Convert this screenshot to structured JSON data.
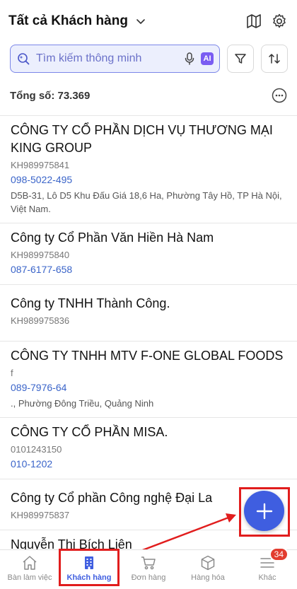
{
  "header": {
    "title": "Tất cả Khách hàng"
  },
  "search": {
    "placeholder": "Tìm kiếm thông minh",
    "ai_badge": "AI"
  },
  "summary": {
    "total_label": "Tổng số: 73.369"
  },
  "customers": [
    {
      "name": "CÔNG TY CỔ PHẦN DỊCH VỤ THƯƠNG MẠI KING GROUP",
      "code": "KH989975841",
      "phone": "098-5022-495",
      "address": "D5B-31, Lô D5 Khu Đấu Giá 18,6 Ha, Phường Tây Hồ, TP Hà Nội, Việt Nam."
    },
    {
      "name": "Công ty Cổ Phần Văn Hiền Hà Nam",
      "code": "KH989975840",
      "phone": "087-6177-658",
      "address": ""
    },
    {
      "name": "Công ty TNHH Thành Công.",
      "code": "KH989975836",
      "phone": "",
      "address": ""
    },
    {
      "name": "CÔNG TY TNHH MTV F-ONE GLOBAL FOODS",
      "code": "f",
      "phone": "089-7976-64",
      "address": "., Phường Đông Triều, Quảng Ninh"
    },
    {
      "name": "CÔNG TY CỔ PHẦN MISA.",
      "code": "0101243150",
      "phone": "010-1202",
      "address": ""
    },
    {
      "name": "Công ty Cổ phần Công nghệ Đại La",
      "code": "KH989975837",
      "phone": "",
      "address": ""
    },
    {
      "name": "Nguyễn Thị Bích Liên",
      "code": "",
      "phone": "",
      "address": ""
    }
  ],
  "tabs": [
    {
      "label": "Bàn làm việc",
      "icon": "home-icon"
    },
    {
      "label": "Khách hàng",
      "icon": "building-icon"
    },
    {
      "label": "Đơn hàng",
      "icon": "cart-icon"
    },
    {
      "label": "Hàng hóa",
      "icon": "box-icon"
    },
    {
      "label": "Khác",
      "icon": "menu-icon"
    }
  ],
  "notifications": {
    "count": "34"
  },
  "colors": {
    "accent": "#3f5ee0",
    "highlight": "#e11d1d",
    "phone": "#3a64c9",
    "badge": "#e23c2f"
  }
}
